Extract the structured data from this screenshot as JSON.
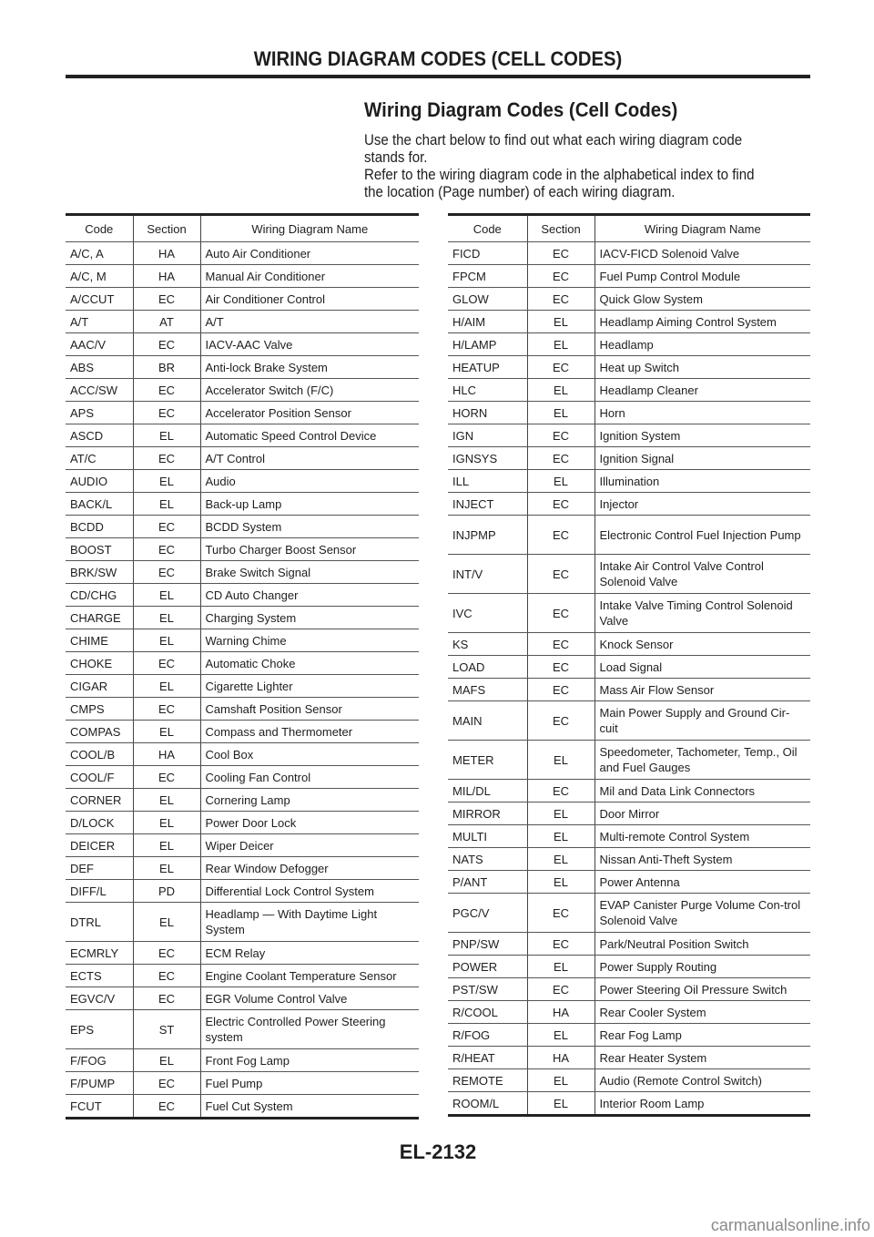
{
  "header": {
    "running_title": "WIRING DIAGRAM CODES (CELL CODES)"
  },
  "section": {
    "title": "Wiring Diagram Codes (Cell Codes)",
    "intro_lines": [
      "Use the chart below to find out what each wiring diagram code",
      "stands for.",
      "Refer to the wiring diagram code in the alphabetical index to find",
      "the location (Page number) of each wiring diagram."
    ]
  },
  "table_columns": [
    "Code",
    "Section",
    "Wiring Diagram Name"
  ],
  "left_table": [
    {
      "code": "A/C, A",
      "section": "HA",
      "name": "Auto Air Conditioner"
    },
    {
      "code": "A/C, M",
      "section": "HA",
      "name": "Manual Air Conditioner"
    },
    {
      "code": "A/CCUT",
      "section": "EC",
      "name": "Air Conditioner Control"
    },
    {
      "code": "A/T",
      "section": "AT",
      "name": "A/T"
    },
    {
      "code": "AAC/V",
      "section": "EC",
      "name": "IACV-AAC Valve"
    },
    {
      "code": "ABS",
      "section": "BR",
      "name": "Anti-lock Brake System"
    },
    {
      "code": "ACC/SW",
      "section": "EC",
      "name": "Accelerator Switch (F/C)"
    },
    {
      "code": "APS",
      "section": "EC",
      "name": "Accelerator Position Sensor"
    },
    {
      "code": "ASCD",
      "section": "EL",
      "name": "Automatic Speed Control Device"
    },
    {
      "code": "AT/C",
      "section": "EC",
      "name": "A/T Control"
    },
    {
      "code": "AUDIO",
      "section": "EL",
      "name": "Audio"
    },
    {
      "code": "BACK/L",
      "section": "EL",
      "name": "Back-up Lamp"
    },
    {
      "code": "BCDD",
      "section": "EC",
      "name": "BCDD System"
    },
    {
      "code": "BOOST",
      "section": "EC",
      "name": "Turbo Charger Boost Sensor"
    },
    {
      "code": "BRK/SW",
      "section": "EC",
      "name": "Brake Switch Signal"
    },
    {
      "code": "CD/CHG",
      "section": "EL",
      "name": "CD Auto Changer"
    },
    {
      "code": "CHARGE",
      "section": "EL",
      "name": "Charging System"
    },
    {
      "code": "CHIME",
      "section": "EL",
      "name": "Warning Chime"
    },
    {
      "code": "CHOKE",
      "section": "EC",
      "name": "Automatic Choke"
    },
    {
      "code": "CIGAR",
      "section": "EL",
      "name": "Cigarette Lighter"
    },
    {
      "code": "CMPS",
      "section": "EC",
      "name": "Camshaft Position Sensor"
    },
    {
      "code": "COMPAS",
      "section": "EL",
      "name": "Compass and Thermometer"
    },
    {
      "code": "COOL/B",
      "section": "HA",
      "name": "Cool Box"
    },
    {
      "code": "COOL/F",
      "section": "EC",
      "name": "Cooling Fan Control"
    },
    {
      "code": "CORNER",
      "section": "EL",
      "name": "Cornering Lamp"
    },
    {
      "code": "D/LOCK",
      "section": "EL",
      "name": "Power Door Lock"
    },
    {
      "code": "DEICER",
      "section": "EL",
      "name": "Wiper Deicer"
    },
    {
      "code": "DEF",
      "section": "EL",
      "name": "Rear Window Defogger"
    },
    {
      "code": "DIFF/L",
      "section": "PD",
      "name": "Differential Lock Control System"
    },
    {
      "code": "DTRL",
      "section": "EL",
      "name": "Headlamp — With Daytime Light System",
      "tall": true
    },
    {
      "code": "ECMRLY",
      "section": "EC",
      "name": "ECM Relay"
    },
    {
      "code": "ECTS",
      "section": "EC",
      "name": "Engine Coolant Temperature Sensor"
    },
    {
      "code": "EGVC/V",
      "section": "EC",
      "name": "EGR Volume Control Valve"
    },
    {
      "code": "EPS",
      "section": "ST",
      "name": "Electric Controlled Power Steering system",
      "tall": true
    },
    {
      "code": "F/FOG",
      "section": "EL",
      "name": "Front Fog Lamp"
    },
    {
      "code": "F/PUMP",
      "section": "EC",
      "name": "Fuel Pump"
    },
    {
      "code": "FCUT",
      "section": "EC",
      "name": "Fuel Cut System"
    }
  ],
  "right_table": [
    {
      "code": "FICD",
      "section": "EC",
      "name": "IACV-FICD Solenoid Valve"
    },
    {
      "code": "FPCM",
      "section": "EC",
      "name": "Fuel Pump Control Module"
    },
    {
      "code": "GLOW",
      "section": "EC",
      "name": "Quick Glow System"
    },
    {
      "code": "H/AIM",
      "section": "EL",
      "name": "Headlamp Aiming Control System"
    },
    {
      "code": "H/LAMP",
      "section": "EL",
      "name": "Headlamp"
    },
    {
      "code": "HEATUP",
      "section": "EC",
      "name": "Heat up Switch"
    },
    {
      "code": "HLC",
      "section": "EL",
      "name": "Headlamp Cleaner"
    },
    {
      "code": "HORN",
      "section": "EL",
      "name": "Horn"
    },
    {
      "code": "IGN",
      "section": "EC",
      "name": "Ignition System"
    },
    {
      "code": "IGNSYS",
      "section": "EC",
      "name": "Ignition Signal"
    },
    {
      "code": "ILL",
      "section": "EL",
      "name": "Illumination"
    },
    {
      "code": "INJECT",
      "section": "EC",
      "name": "Injector"
    },
    {
      "code": "INJPMP",
      "section": "EC",
      "name": "Electronic Control Fuel Injection Pump",
      "tall": true
    },
    {
      "code": "INT/V",
      "section": "EC",
      "name": "Intake Air Control Valve Control Solenoid Valve",
      "tall": true
    },
    {
      "code": "IVC",
      "section": "EC",
      "name": "Intake Valve Timing Control Solenoid Valve",
      "tall": true
    },
    {
      "code": "KS",
      "section": "EC",
      "name": "Knock Sensor"
    },
    {
      "code": "LOAD",
      "section": "EC",
      "name": "Load Signal"
    },
    {
      "code": "MAFS",
      "section": "EC",
      "name": "Mass Air Flow Sensor"
    },
    {
      "code": "MAIN",
      "section": "EC",
      "name": "Main Power Supply and Ground Cir-cuit",
      "tall": true
    },
    {
      "code": "METER",
      "section": "EL",
      "name": "Speedometer, Tachometer, Temp., Oil and Fuel Gauges",
      "tall": true
    },
    {
      "code": "MIL/DL",
      "section": "EC",
      "name": "Mil and Data Link Connectors"
    },
    {
      "code": "MIRROR",
      "section": "EL",
      "name": "Door Mirror"
    },
    {
      "code": "MULTI",
      "section": "EL",
      "name": "Multi-remote Control System"
    },
    {
      "code": "NATS",
      "section": "EL",
      "name": "Nissan Anti-Theft System"
    },
    {
      "code": "P/ANT",
      "section": "EL",
      "name": "Power Antenna"
    },
    {
      "code": "PGC/V",
      "section": "EC",
      "name": "EVAP Canister Purge Volume Con-trol Solenoid Valve",
      "tall": true
    },
    {
      "code": "PNP/SW",
      "section": "EC",
      "name": "Park/Neutral Position Switch"
    },
    {
      "code": "POWER",
      "section": "EL",
      "name": "Power Supply Routing"
    },
    {
      "code": "PST/SW",
      "section": "EC",
      "name": "Power Steering Oil Pressure Switch"
    },
    {
      "code": "R/COOL",
      "section": "HA",
      "name": "Rear Cooler System"
    },
    {
      "code": "R/FOG",
      "section": "EL",
      "name": "Rear Fog Lamp"
    },
    {
      "code": "R/HEAT",
      "section": "HA",
      "name": "Rear Heater System"
    },
    {
      "code": "REMOTE",
      "section": "EL",
      "name": "Audio (Remote Control Switch)"
    },
    {
      "code": "ROOM/L",
      "section": "EL",
      "name": "Interior Room Lamp"
    }
  ],
  "footer": {
    "page_number": "EL-2132",
    "watermark": "carmanualsonline.info"
  }
}
